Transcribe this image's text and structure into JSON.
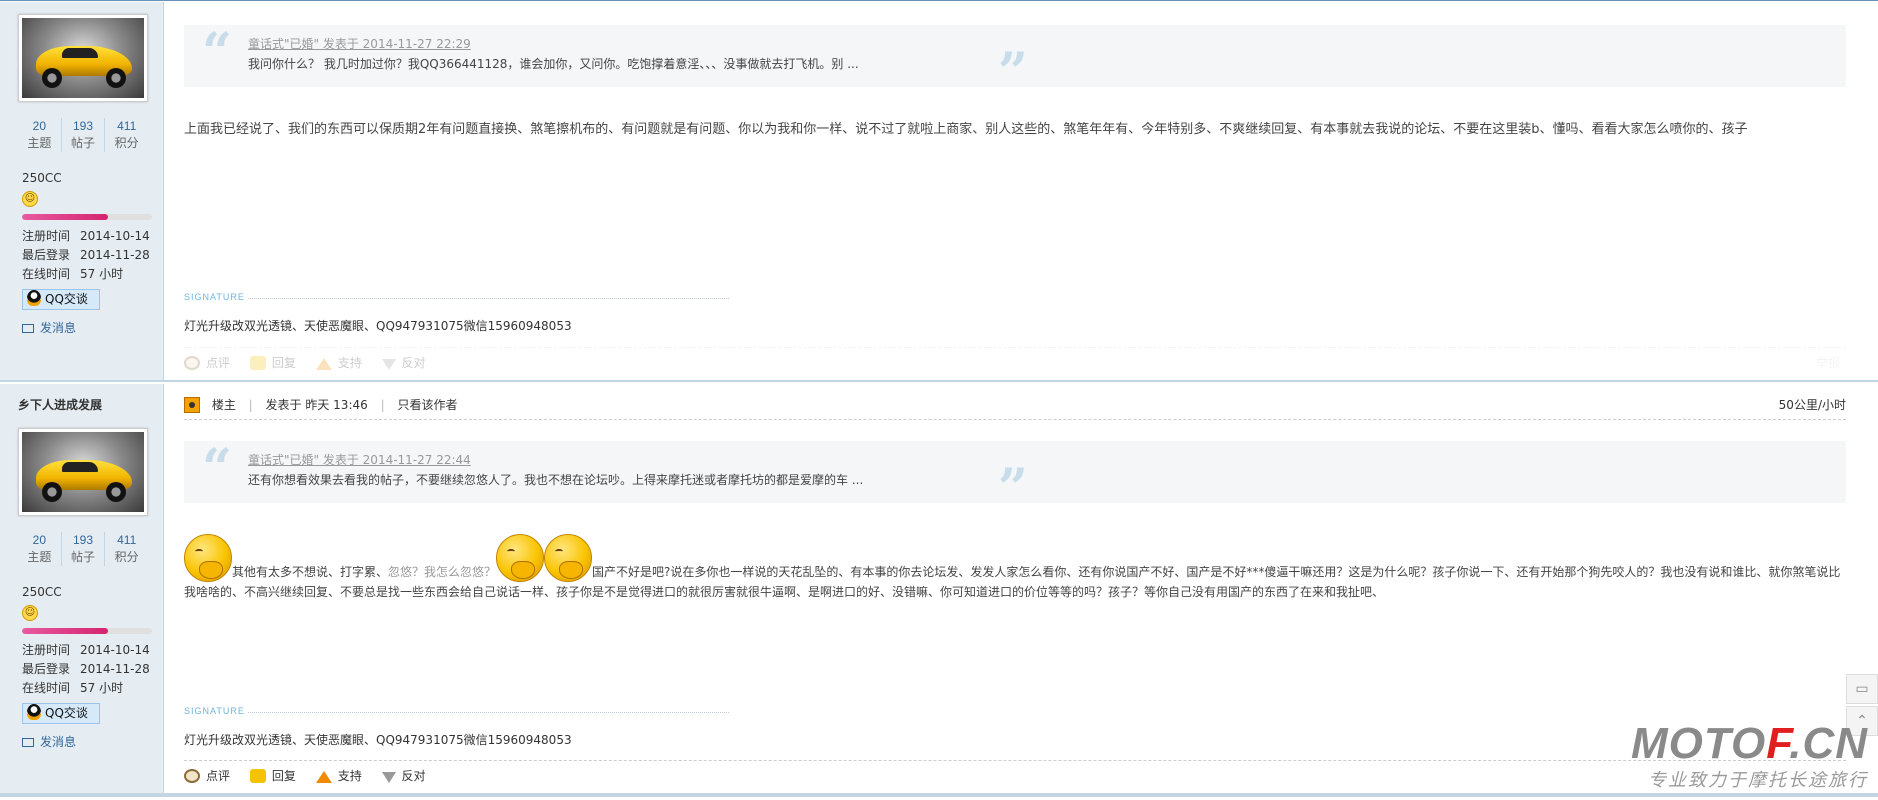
{
  "post1": {
    "author": {
      "stats": [
        {
          "num": "20",
          "label": "主题"
        },
        {
          "num": "193",
          "label": "帖子"
        },
        {
          "num": "411",
          "label": "积分"
        }
      ],
      "group": "250CC",
      "level_progress": 0.66,
      "info": [
        {
          "k": "注册时间",
          "v": "2014-10-14"
        },
        {
          "k": "最后登录",
          "v": "2014-11-28"
        },
        {
          "k": "在线时间",
          "v": "57 小时"
        }
      ],
      "qq_label": "QQ交谈",
      "message_label": "发消息"
    },
    "quote": {
      "author": "童话式\"已婚\" 发表于 2014-11-27 22:29",
      "text": "我问你什么？ 我几时加过你？我QQ366441128，谁会加你，又问你。吃饱撑着意淫、、、没事做就去打飞机。别 ..."
    },
    "text": "上面我已经说了、我们的东西可以保质期2年有问题直接换、煞笔擦机布的、有问题就是有问题、你以为我和你一样、说不过了就啦上商家、别人这些的、煞笔年年有、今年特别多、不爽继续回复、有本事就去我说的论坛、不要在这里装b、懂吗、看看大家怎么喷你的、孩子",
    "signature_label": "SIGNATURE",
    "signature": "灯光升级改双光透镜、天使恶魔眼、QQ947931075微信15960948053",
    "actions": {
      "comment": "点评",
      "reply": "回复",
      "support": "支持",
      "oppose": "反对",
      "report": "举报"
    }
  },
  "post2": {
    "author": {
      "name": "乡下人进成发展",
      "stats": [
        {
          "num": "20",
          "label": "主题"
        },
        {
          "num": "193",
          "label": "帖子"
        },
        {
          "num": "411",
          "label": "积分"
        }
      ],
      "group": "250CC",
      "level_progress": 0.66,
      "info": [
        {
          "k": "注册时间",
          "v": "2014-10-14"
        },
        {
          "k": "最后登录",
          "v": "2014-11-28"
        },
        {
          "k": "在线时间",
          "v": "57 小时"
        }
      ],
      "qq_label": "QQ交谈",
      "message_label": "发消息"
    },
    "header": {
      "role": "楼主",
      "posted": "发表于 昨天 13:46",
      "only_author": "只看该作者",
      "right_label": "50公里/小时"
    },
    "quote": {
      "author": "童话式\"已婚\" 发表于 2014-11-27 22:44",
      "text": "还有你想看效果去看我的帖子，不要继续忽悠人了。我也不想在论坛吵。上得来摩托迷或者摩托坊的都是爱摩的车 ..."
    },
    "text_a": "其他有太多不想说、打字累、",
    "text_b": "忽悠？我怎么忽悠？",
    "text_c": "国产不好是吧?说在多你也一样说的天花乱坠的、有本事的你去论坛发、发发人家怎么看你、还有你说国产不好、国产是不好***傻逼干嘛还用？这是为什么呢？孩子你说一下、还有开始那个狗先咬人的？我也没有说和谁比、就你煞笔说比我啥啥的、不高兴继续回复、不要总是找一些东西会给自己说话一样、孩子你是不是觉得进口的就很厉害就很牛逼啊、是啊进口的好、没错嘛、你可知道进口的价位等等的吗？孩子？等你自己没有用国产的东西了在来和我扯吧、",
    "signature_label": "SIGNATURE",
    "signature": "灯光升级改双光透镜、天使恶魔眼、QQ947931075微信15960948053",
    "actions": {
      "comment": "点评",
      "reply": "回复",
      "support": "支持",
      "oppose": "反对"
    }
  },
  "watermark": {
    "brand_a": "MOTO",
    "brand_b": "F",
    "brand_c": ".CN",
    "slogan": "专业致力于摩托长途旅行"
  },
  "icons": [
    "smile-icon",
    "qq-icon",
    "envelope-icon",
    "comment-icon",
    "reply-icon",
    "support-icon",
    "oppose-icon",
    "crown-icon",
    "quote-open-icon",
    "quote-close-icon",
    "laugh-emoticon-icon",
    "feedback-icon",
    "back-to-top-icon"
  ],
  "colors": {
    "sidebar_bg": "#e5edf2",
    "link": "#336699",
    "quote_mark": "#c8dcea",
    "brand_red": "#e02020"
  }
}
